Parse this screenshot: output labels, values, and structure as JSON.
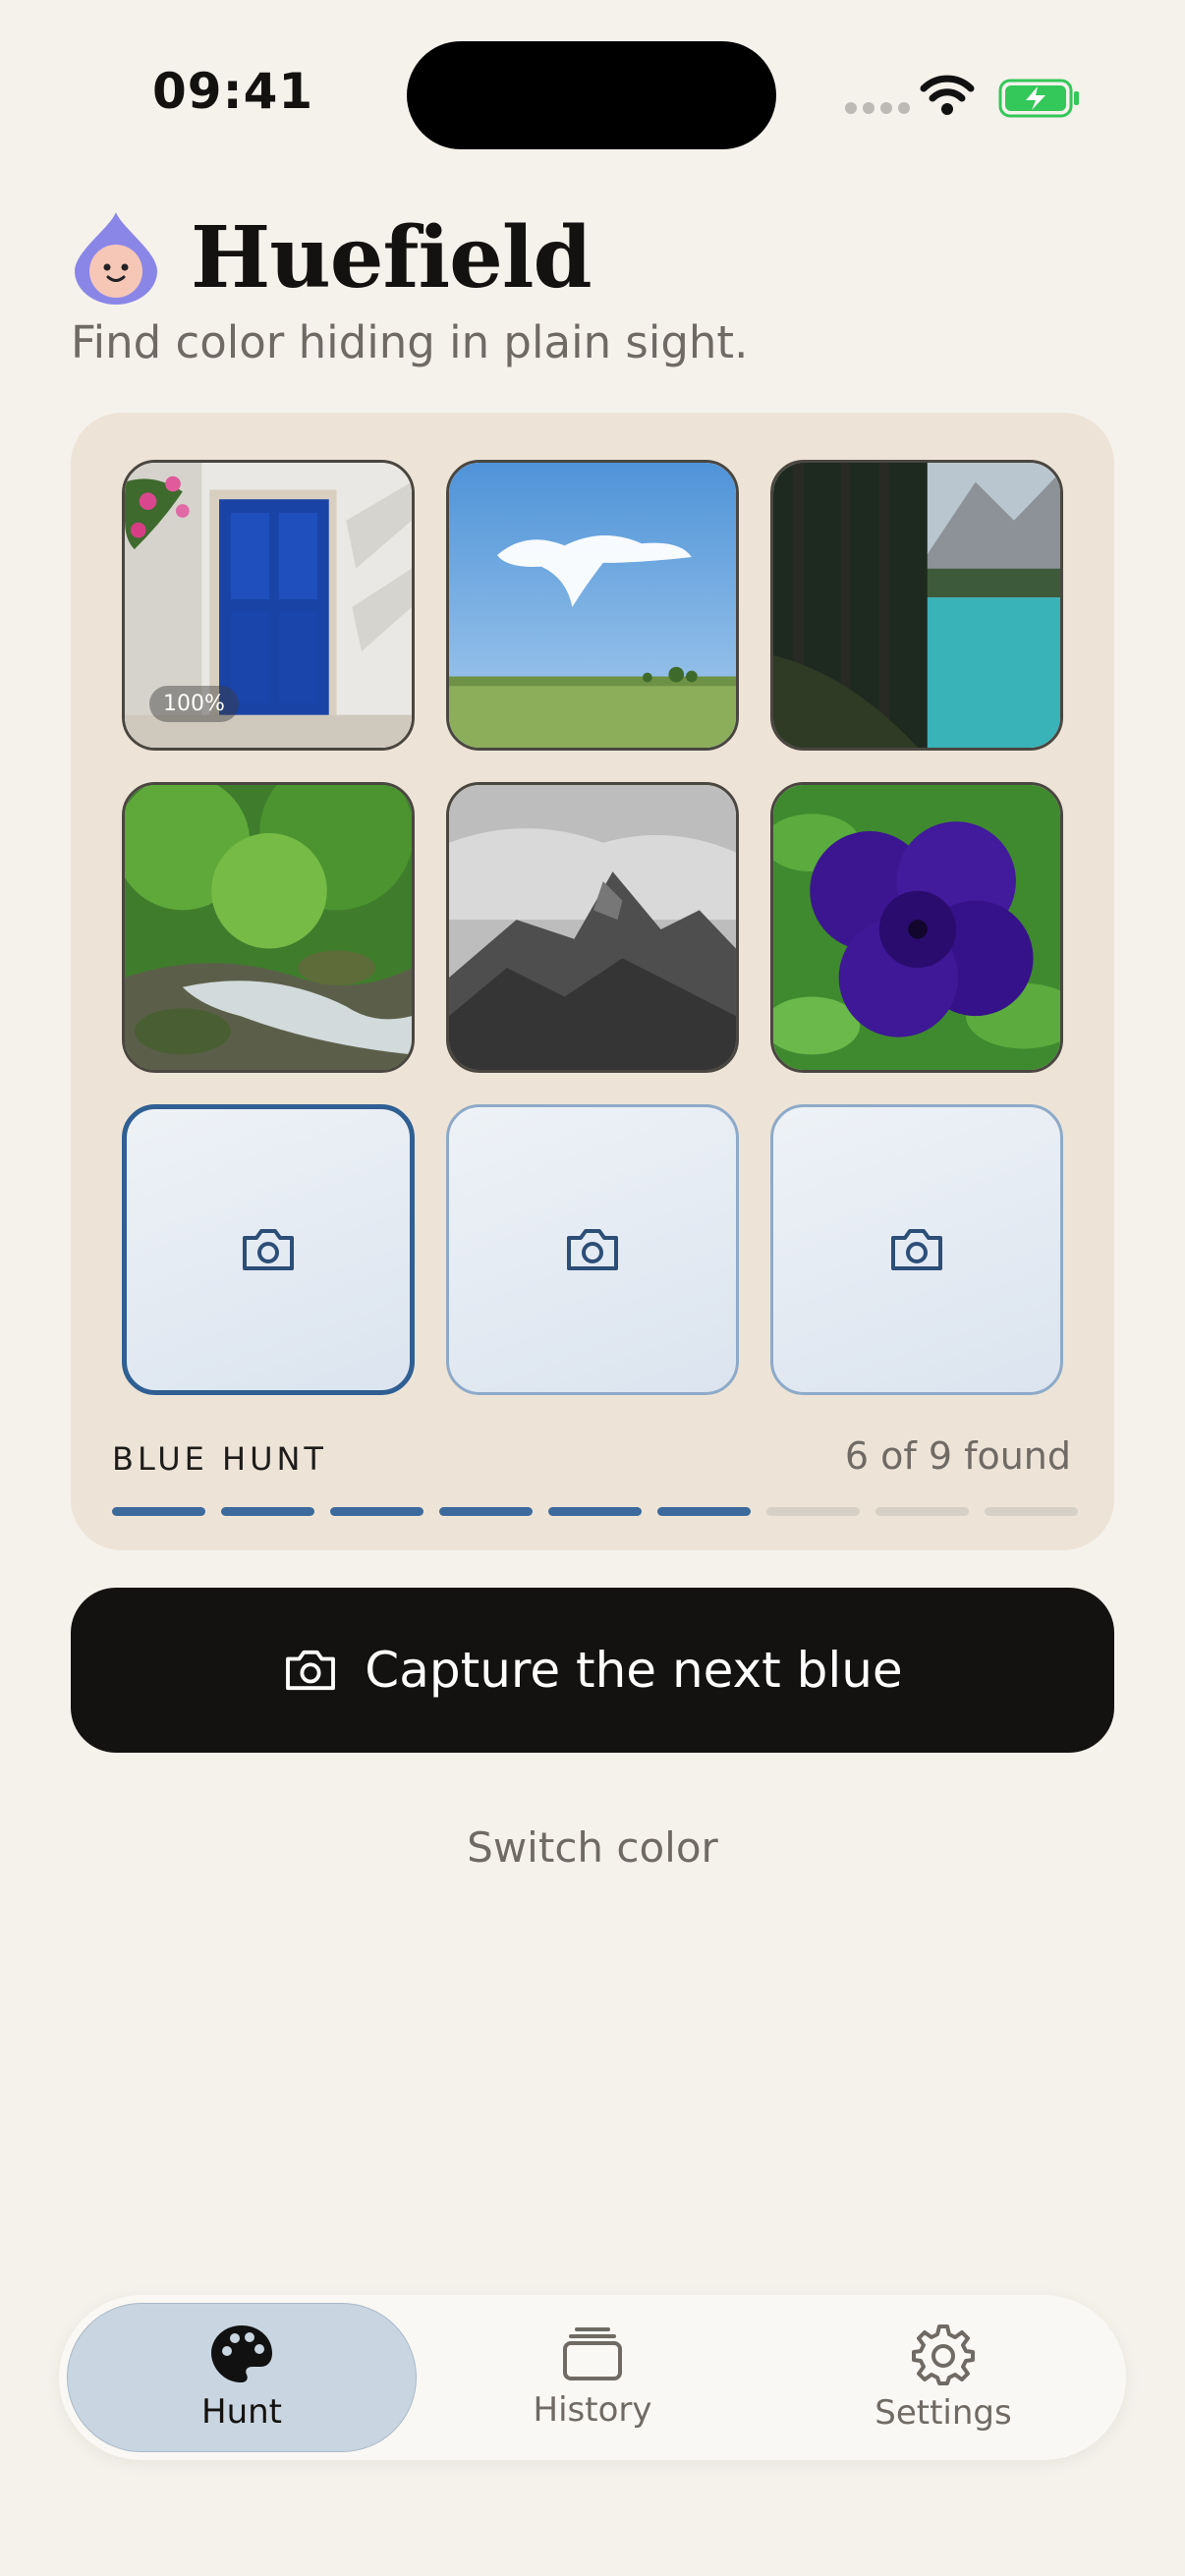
{
  "status_bar": {
    "time": "09:41",
    "icons": [
      "cellular-icon",
      "wifi-icon",
      "battery-charging-icon"
    ],
    "battery_color": "#34c759"
  },
  "header": {
    "title": "Huefield",
    "subtitle": "Find color hiding in plain sight.",
    "logo_icon": "droplet-face-icon"
  },
  "hunt": {
    "photos": [
      {
        "name": "photo-blue-door",
        "badge": "100%"
      },
      {
        "name": "photo-sky-field"
      },
      {
        "name": "photo-forest-lake"
      },
      {
        "name": "photo-forest-stream"
      },
      {
        "name": "photo-misty-mountain"
      },
      {
        "name": "photo-purple-flower"
      }
    ],
    "empty_slots": 3,
    "label": "BLUE HUNT",
    "count": "6 of 9 found",
    "progress_found": 6,
    "progress_total": 9,
    "accent_color": "#3d6a9c"
  },
  "actions": {
    "capture_label": "Capture the next blue",
    "switch_label": "Switch color"
  },
  "tabs": [
    {
      "label": "Hunt",
      "icon": "palette-icon",
      "active": true
    },
    {
      "label": "History",
      "icon": "stack-icon",
      "active": false
    },
    {
      "label": "Settings",
      "icon": "gear-icon",
      "active": false
    }
  ]
}
